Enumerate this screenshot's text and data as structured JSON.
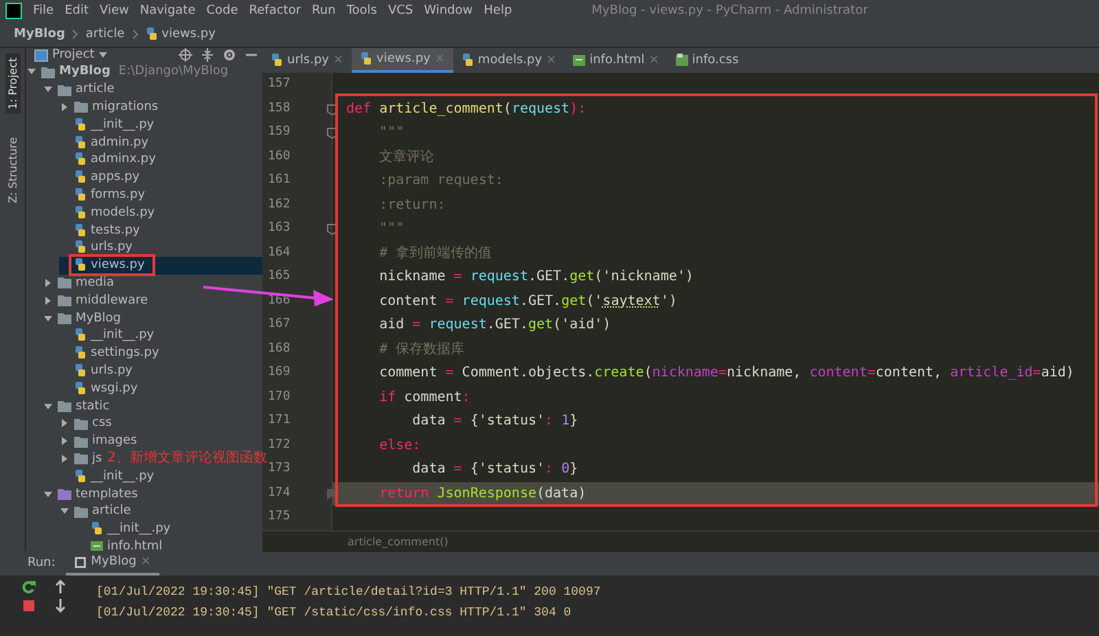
{
  "menu_bar": {
    "items": [
      "File",
      "Edit",
      "View",
      "Navigate",
      "Code",
      "Refactor",
      "Run",
      "Tools",
      "VCS",
      "Window",
      "Help"
    ],
    "title": "MyBlog - views.py - PyCharm - Administrator"
  },
  "nav_bar": {
    "crumbs": [
      {
        "label": "MyBlog",
        "kind": "project"
      },
      {
        "label": "article",
        "kind": "folder"
      },
      {
        "label": "views.py",
        "kind": "py"
      }
    ]
  },
  "tool_strip": [
    {
      "label": "1: Project",
      "selected": true
    },
    {
      "label": "Z: Structure",
      "selected": false
    }
  ],
  "project_panel": {
    "title": "Project",
    "tree": [
      {
        "label": "MyBlog",
        "path": "E:\\Django\\MyBlog",
        "kind": "folder",
        "expanded": true,
        "selected": false,
        "children": [
          {
            "label": "article",
            "kind": "folder",
            "expanded": true,
            "selected": false,
            "children": [
              {
                "label": "migrations",
                "kind": "folder",
                "expanded": false,
                "selected": false
              },
              {
                "label": "__init__.py",
                "kind": "py",
                "selected": false
              },
              {
                "label": "admin.py",
                "kind": "py",
                "selected": false
              },
              {
                "label": "adminx.py",
                "kind": "py",
                "selected": false
              },
              {
                "label": "apps.py",
                "kind": "py",
                "selected": false
              },
              {
                "label": "forms.py",
                "kind": "py",
                "selected": false
              },
              {
                "label": "models.py",
                "kind": "py",
                "selected": false
              },
              {
                "label": "tests.py",
                "kind": "py",
                "selected": false
              },
              {
                "label": "urls.py",
                "kind": "py",
                "selected": false
              },
              {
                "label": "views.py",
                "kind": "py",
                "selected": true
              }
            ]
          },
          {
            "label": "media",
            "kind": "folder",
            "expanded": false,
            "selected": false
          },
          {
            "label": "middleware",
            "kind": "folder",
            "expanded": false,
            "selected": false
          },
          {
            "label": "MyBlog",
            "kind": "folder",
            "expanded": true,
            "selected": false,
            "children": [
              {
                "label": "__init__.py",
                "kind": "py",
                "selected": false
              },
              {
                "label": "settings.py",
                "kind": "py",
                "selected": false
              },
              {
                "label": "urls.py",
                "kind": "py",
                "selected": false
              },
              {
                "label": "wsgi.py",
                "kind": "py",
                "selected": false
              }
            ]
          },
          {
            "label": "static",
            "kind": "folder",
            "expanded": true,
            "selected": false,
            "children": [
              {
                "label": "css",
                "kind": "folder",
                "expanded": false,
                "selected": false
              },
              {
                "label": "images",
                "kind": "folder",
                "expanded": false,
                "selected": false
              },
              {
                "label": "js",
                "kind": "folder",
                "expanded": false,
                "selected": false
              },
              {
                "label": "__init__.py",
                "kind": "py",
                "selected": false
              }
            ]
          },
          {
            "label": "templates",
            "kind": "tplfolder",
            "expanded": true,
            "selected": false,
            "children": [
              {
                "label": "article",
                "kind": "folder",
                "expanded": true,
                "selected": false,
                "children": [
                  {
                    "label": "__init__.py",
                    "kind": "py",
                    "selected": false
                  },
                  {
                    "label": "info.html",
                    "kind": "html",
                    "selected": false
                  }
                ]
              }
            ]
          }
        ]
      }
    ]
  },
  "editor_tabs": [
    {
      "label": "urls.py",
      "kind": "py",
      "selected": false,
      "close": "×"
    },
    {
      "label": "views.py",
      "kind": "py",
      "selected": true,
      "close": "×"
    },
    {
      "label": "models.py",
      "kind": "py",
      "selected": false,
      "close": "×"
    },
    {
      "label": "info.html",
      "kind": "html",
      "selected": false,
      "close": "×"
    },
    {
      "label": "info.css",
      "kind": "css",
      "selected": false
    }
  ],
  "code_lines": [
    {
      "number": "157"
    },
    {
      "number": "158",
      "current": false,
      "gutter_mark": {
        "kind": "fold"
      },
      "tokens": [
        {
          "text": "def ",
          "kind": "kw"
        },
        {
          "text": "article_comment",
          "kind": "fn"
        },
        {
          "text": "(",
          "kind": "plain"
        },
        {
          "text": "request",
          "kind": "param"
        },
        {
          "text": "):",
          "kind": "op"
        }
      ]
    },
    {
      "number": "159",
      "current": false,
      "gutter_mark": {
        "kind": "fold"
      },
      "tokens": [
        {
          "text": "    \"\"\"",
          "kind": "doc"
        }
      ]
    },
    {
      "number": "160",
      "current": false,
      "tokens": [
        {
          "text": "    文章评论",
          "kind": "doc"
        }
      ]
    },
    {
      "number": "161",
      "current": false,
      "tokens": [
        {
          "text": "    :param request:",
          "kind": "doc"
        }
      ]
    },
    {
      "number": "162",
      "current": false,
      "tokens": [
        {
          "text": "    :return:",
          "kind": "doc"
        }
      ]
    },
    {
      "number": "163",
      "current": false,
      "gutter_mark": {
        "kind": "fold"
      },
      "tokens": [
        {
          "text": "    \"\"\"",
          "kind": "doc"
        }
      ]
    },
    {
      "number": "164",
      "current": false,
      "tokens": [
        {
          "text": "    # 拿到前端传的值",
          "kind": "com"
        }
      ]
    },
    {
      "number": "165",
      "current": false,
      "tokens": [
        {
          "text": "    nickname ",
          "kind": "plain"
        },
        {
          "text": "= ",
          "kind": "op"
        },
        {
          "text": "request",
          "kind": "param"
        },
        {
          "text": ".GET.",
          "kind": "plain"
        },
        {
          "text": "get",
          "kind": "call"
        },
        {
          "text": "('nickname')",
          "kind": "str"
        }
      ]
    },
    {
      "number": "166",
      "current": false,
      "tokens": [
        {
          "text": "    content ",
          "kind": "plain"
        },
        {
          "text": "= ",
          "kind": "op"
        },
        {
          "text": "request",
          "kind": "param"
        },
        {
          "text": ".GET.",
          "kind": "plain"
        },
        {
          "text": "get",
          "kind": "call"
        },
        {
          "text": "('",
          "kind": "str"
        },
        {
          "text": "saytext",
          "kind": "typo"
        },
        {
          "text": "')",
          "kind": "str"
        }
      ]
    },
    {
      "number": "167",
      "current": false,
      "tokens": [
        {
          "text": "    aid ",
          "kind": "plain"
        },
        {
          "text": "= ",
          "kind": "op"
        },
        {
          "text": "request",
          "kind": "param"
        },
        {
          "text": ".GET.",
          "kind": "plain"
        },
        {
          "text": "get",
          "kind": "call"
        },
        {
          "text": "('aid')",
          "kind": "str"
        }
      ]
    },
    {
      "number": "168",
      "current": false,
      "tokens": [
        {
          "text": "    # 保存数据库",
          "kind": "com"
        }
      ]
    },
    {
      "number": "169",
      "current": false,
      "tokens": [
        {
          "text": "    comment ",
          "kind": "plain"
        },
        {
          "text": "= ",
          "kind": "op"
        },
        {
          "text": "Comment.objects.",
          "kind": "plain"
        },
        {
          "text": "create",
          "kind": "call"
        },
        {
          "text": "(",
          "kind": "plain"
        },
        {
          "text": "nickname",
          "kind": "kwarg"
        },
        {
          "text": "=",
          "kind": "op"
        },
        {
          "text": "nickname, ",
          "kind": "plain"
        },
        {
          "text": "content",
          "kind": "kwarg"
        },
        {
          "text": "=",
          "kind": "op"
        },
        {
          "text": "content, ",
          "kind": "plain"
        },
        {
          "text": "article_id",
          "kind": "kwarg"
        },
        {
          "text": "=",
          "kind": "op"
        },
        {
          "text": "aid)",
          "kind": "plain"
        }
      ]
    },
    {
      "number": "170",
      "current": false,
      "tokens": [
        {
          "text": "    if",
          "kind": "kw"
        },
        {
          "text": " comment",
          "kind": "plain"
        },
        {
          "text": ":",
          "kind": "op"
        }
      ]
    },
    {
      "number": "171",
      "current": false,
      "tokens": [
        {
          "text": "        data ",
          "kind": "plain"
        },
        {
          "text": "= ",
          "kind": "op"
        },
        {
          "text": "{",
          "kind": "plain"
        },
        {
          "text": "'status'",
          "kind": "str"
        },
        {
          "text": ": ",
          "kind": "op"
        },
        {
          "text": "1",
          "kind": "num"
        },
        {
          "text": "}",
          "kind": "plain"
        }
      ]
    },
    {
      "number": "172",
      "current": false,
      "tokens": [
        {
          "text": "    else",
          "kind": "kw"
        },
        {
          "text": ":",
          "kind": "op"
        }
      ]
    },
    {
      "number": "173",
      "current": false,
      "tokens": [
        {
          "text": "        data ",
          "kind": "plain"
        },
        {
          "text": "= ",
          "kind": "op"
        },
        {
          "text": "{",
          "kind": "plain"
        },
        {
          "text": "'status'",
          "kind": "str"
        },
        {
          "text": ": ",
          "kind": "op"
        },
        {
          "text": "0",
          "kind": "num"
        },
        {
          "text": "}",
          "kind": "plain"
        }
      ]
    },
    {
      "number": "174",
      "current": true,
      "gutter_mark": {
        "kind": "bookmark"
      },
      "tokens": [
        {
          "text": "    return ",
          "kind": "kw"
        },
        {
          "text": "JsonResponse",
          "kind": "call"
        },
        {
          "text": "(data)",
          "kind": "plain"
        }
      ]
    },
    {
      "number": "175"
    }
  ],
  "editor_breadcrumb": "article_comment()",
  "run_panel": {
    "label": "Run:",
    "tab": {
      "label": "MyBlog",
      "close": "×",
      "selected": true
    },
    "log": [
      "[01/Jul/2022 19:30:45] \"GET /article/detail?id=3 HTTP/1.1\" 200 10097",
      "[01/Jul/2022 19:30:45] \"GET /static/css/info.css HTTP/1.1\" 304 0"
    ]
  },
  "annotation": {
    "label": "2、新增文章评论视图函数"
  }
}
